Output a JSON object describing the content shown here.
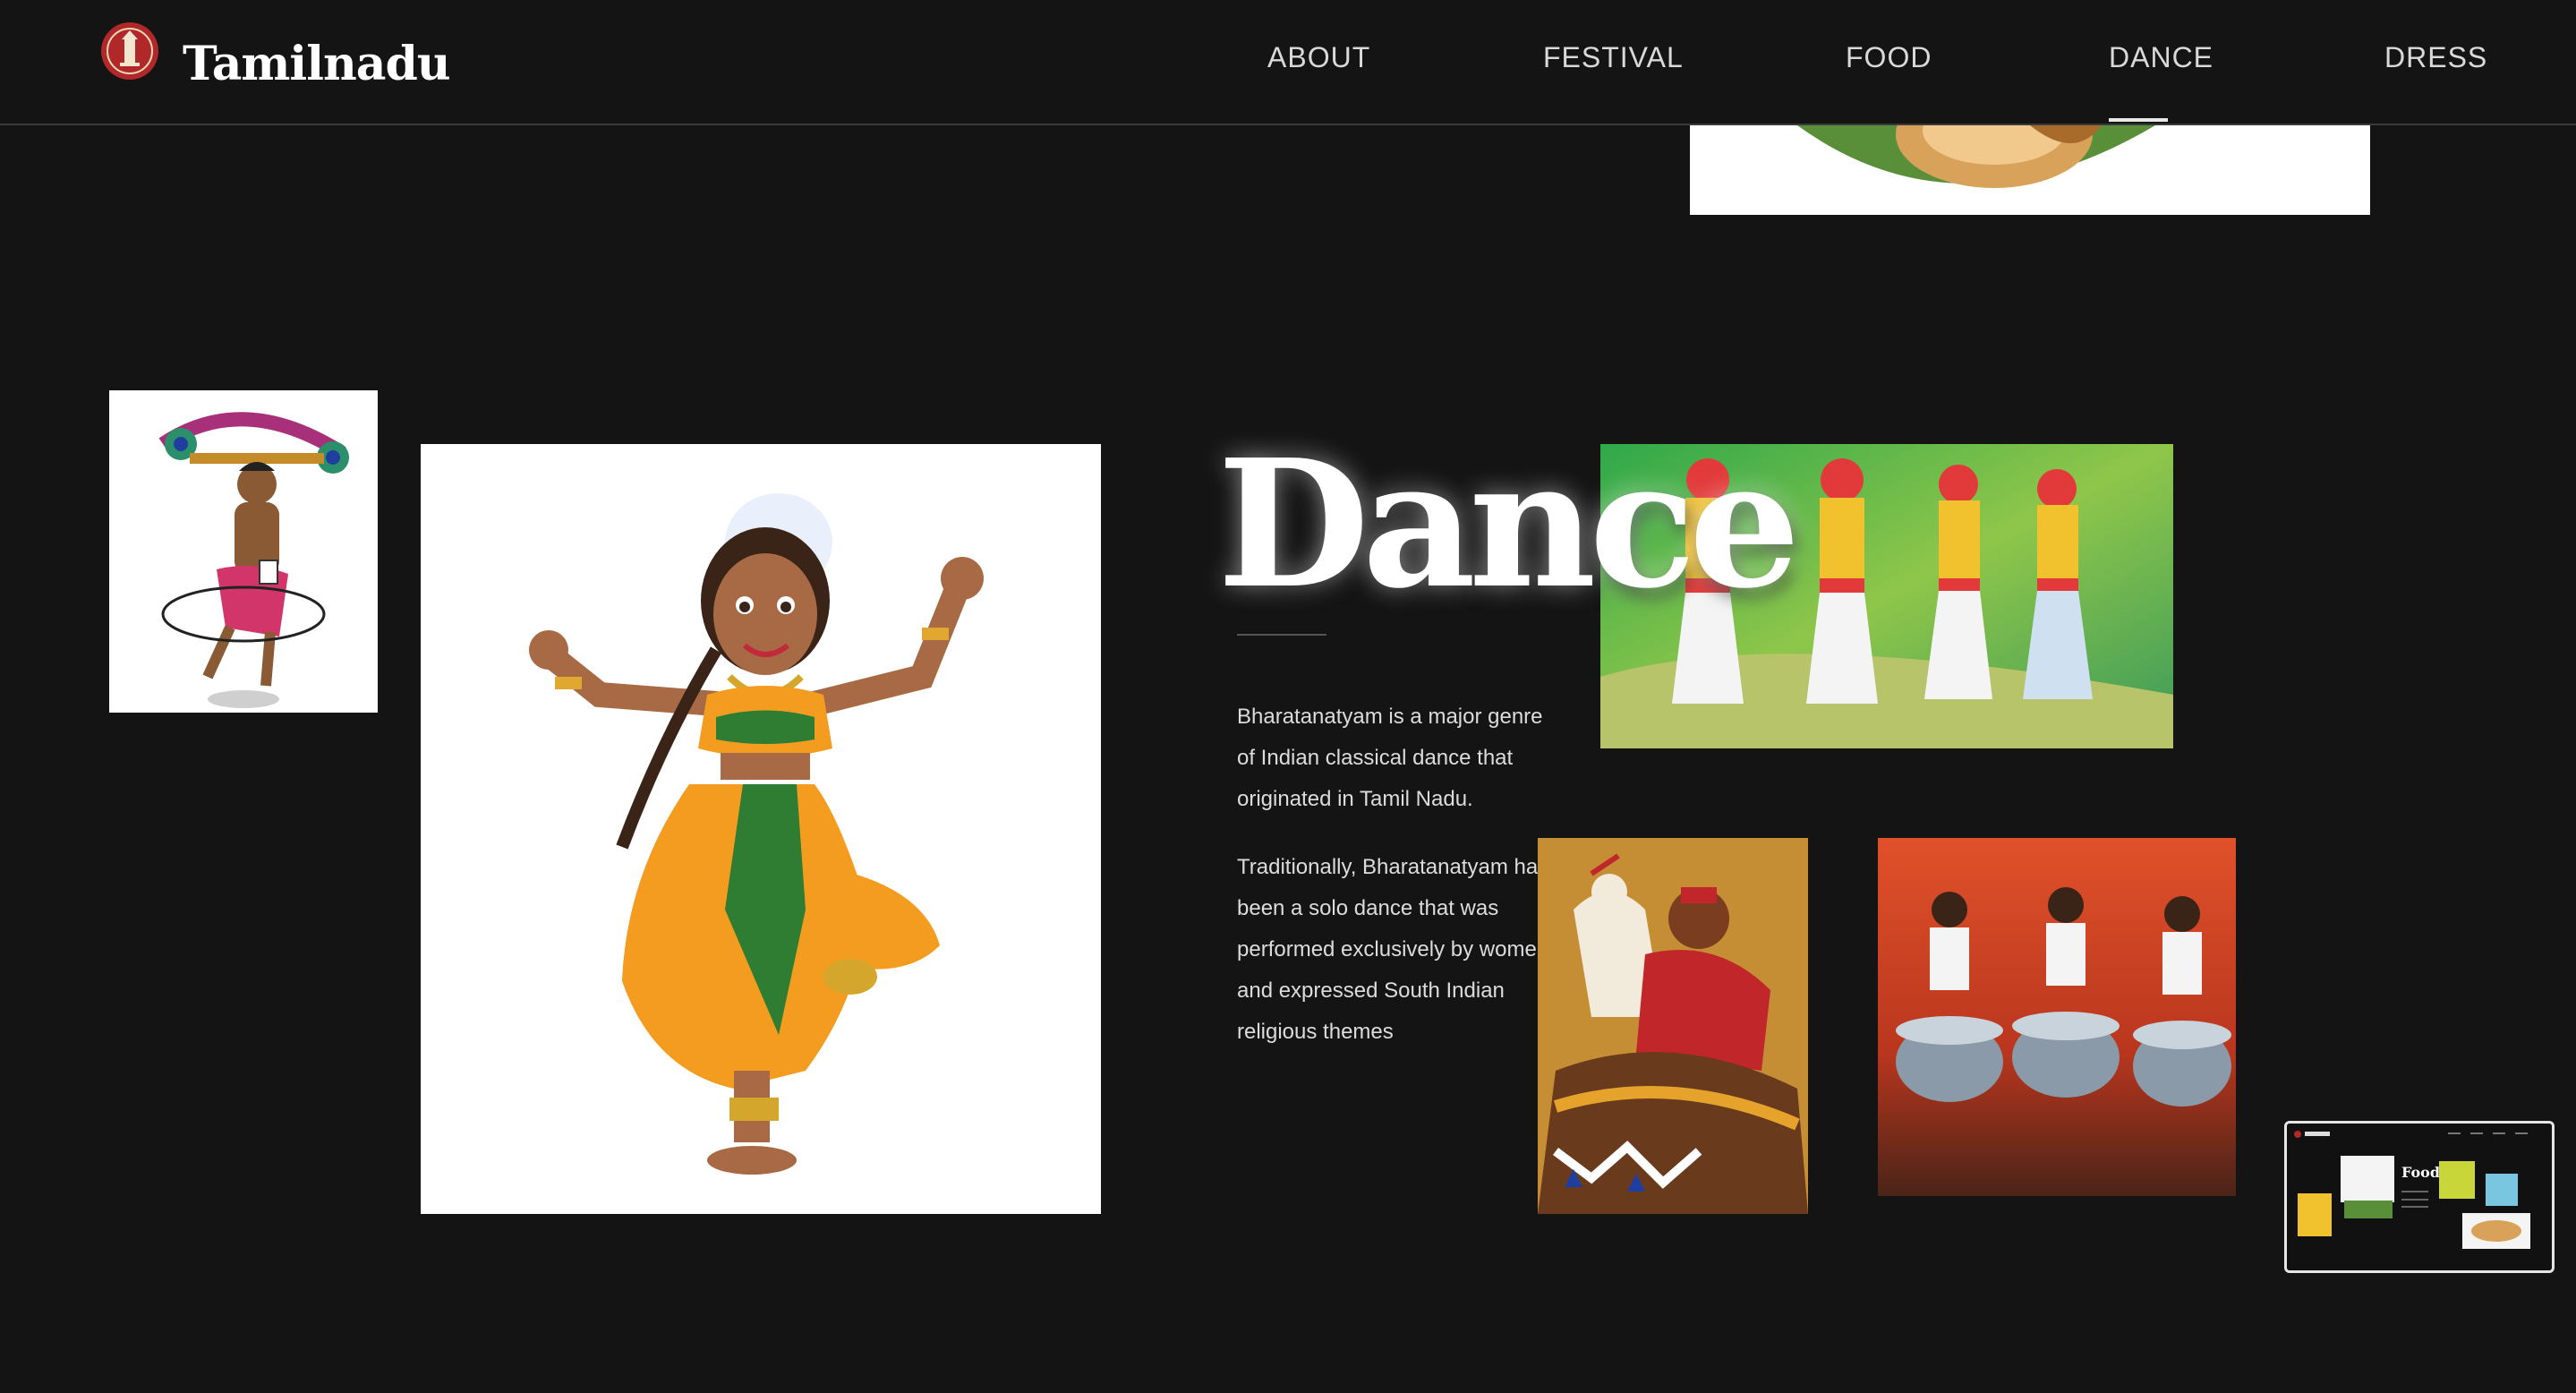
{
  "header": {
    "brand": "Tamilnadu",
    "logo_icon": "tamilnadu-emblem-icon",
    "nav": [
      {
        "label": "ABOUT"
      },
      {
        "label": "FESTIVAL"
      },
      {
        "label": "FOOD"
      },
      {
        "label": "DANCE",
        "active": true
      },
      {
        "label": "DRESS"
      }
    ]
  },
  "section": {
    "title": "Dance",
    "paragraphs": [
      "Bharatanatyam is a major genre of Indian classical dance that originated in Tamil Nadu.",
      "Traditionally, Bharatanatyam has been a solo dance that was performed exclusively by women, and expressed South Indian religious themes"
    ]
  },
  "images": [
    {
      "name": "kavadi-dancer-image",
      "icon": "kavadi-dancer"
    },
    {
      "name": "bharatanatyam-dancer-image",
      "icon": "bharatanatyam-dancer"
    },
    {
      "name": "folk-dancers-painting",
      "icon": "folk-dancers"
    },
    {
      "name": "horse-dance-painting",
      "icon": "poikkal-kuthirai"
    },
    {
      "name": "drummers-painting",
      "icon": "drummers"
    },
    {
      "name": "food-banana-leaf-image",
      "icon": "banana-leaf-plate"
    }
  ],
  "preview": {
    "brand": "Tamilnadu",
    "title": "Food"
  },
  "colors": {
    "background": "#141414",
    "text": "#ffffff",
    "nav_text": "#d9d9d9",
    "accent_orange": "#f39c1f",
    "accent_green": "#2e7d32"
  }
}
